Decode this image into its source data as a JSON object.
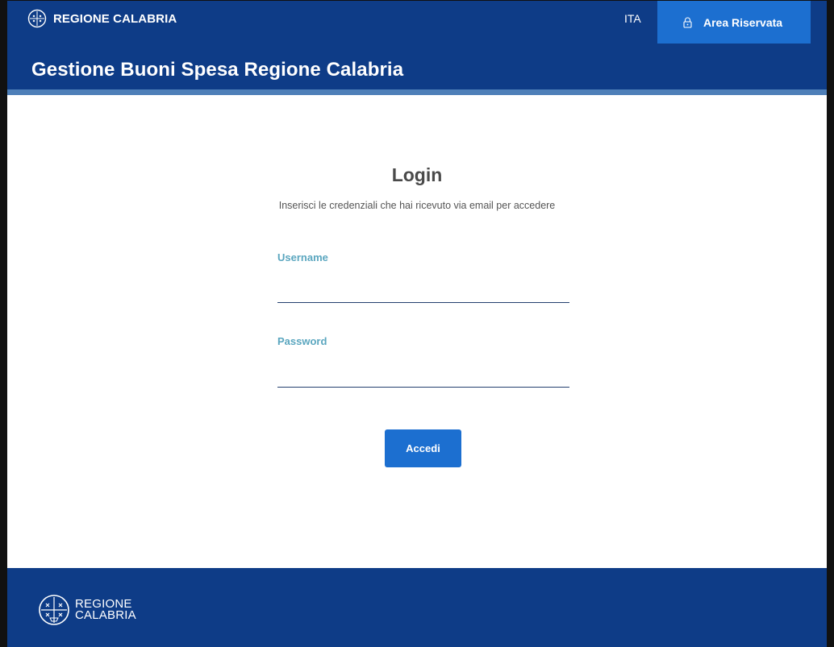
{
  "header": {
    "brand_name": "REGIONE CALABRIA",
    "brand_logo_icon": "regione-calabria-emblem-icon",
    "language": "ITA",
    "area_riservata_label": "Area Riservata",
    "area_riservata_icon": "lock-icon",
    "site_title": "Gestione Buoni Spesa Regione Calabria"
  },
  "login": {
    "title": "Login",
    "subtitle": "Inserisci le credenziali che hai ricevuto via email per accedere",
    "username_label": "Username",
    "username_value": "",
    "password_label": "Password",
    "password_value": "",
    "submit_label": "Accedi"
  },
  "footer": {
    "brand_line1": "REGIONE",
    "brand_line2": "CALABRIA",
    "brand_logo_icon": "regione-calabria-emblem-icon"
  },
  "colors": {
    "header_bg": "#0e3c87",
    "accent": "#1c6fd0",
    "label": "#5aa6bf",
    "stripe": "#4e7fb8"
  }
}
